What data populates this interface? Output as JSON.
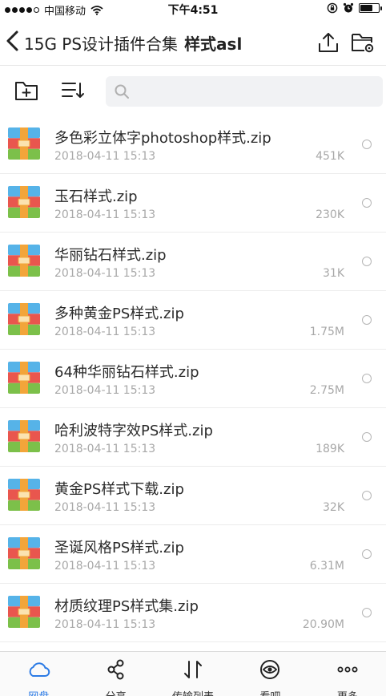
{
  "status_bar": {
    "carrier": "中国移动",
    "time": "下午4:51"
  },
  "nav": {
    "breadcrumb": "15G PS设计插件合集",
    "current_folder": "样式asl"
  },
  "search": {
    "value": "",
    "placeholder": ""
  },
  "files": [
    {
      "name": "多色彩立体字photoshop样式.zip",
      "date": "2018-04-11 15:13",
      "size": "451K"
    },
    {
      "name": "玉石样式.zip",
      "date": "2018-04-11 15:13",
      "size": "230K"
    },
    {
      "name": "华丽钻石样式.zip",
      "date": "2018-04-11 15:13",
      "size": "31K"
    },
    {
      "name": "多种黄金PS样式.zip",
      "date": "2018-04-11 15:13",
      "size": "1.75M"
    },
    {
      "name": "64种华丽钻石样式.zip",
      "date": "2018-04-11 15:13",
      "size": "2.75M"
    },
    {
      "name": "哈利波特字效PS样式.zip",
      "date": "2018-04-11 15:13",
      "size": "189K"
    },
    {
      "name": "黄金PS样式下载.zip",
      "date": "2018-04-11 15:13",
      "size": "32K"
    },
    {
      "name": "圣诞风格PS样式.zip",
      "date": "2018-04-11 15:13",
      "size": "6.31M"
    },
    {
      "name": "材质纹理PS样式集.zip",
      "date": "2018-04-11 15:13",
      "size": "20.90M"
    }
  ],
  "tabs": [
    {
      "label": "网盘",
      "icon": "cloud-icon",
      "active": true
    },
    {
      "label": "分享",
      "icon": "share-icon",
      "active": false
    },
    {
      "label": "传输列表",
      "icon": "transfer-icon",
      "active": false
    },
    {
      "label": "看吧",
      "icon": "eye-icon",
      "active": false
    },
    {
      "label": "更多",
      "icon": "more-icon",
      "active": false
    }
  ],
  "colors": {
    "accent": "#2c7be5",
    "zip_blue": "#56b3e8",
    "zip_red": "#e9564e",
    "zip_green": "#7cc04a",
    "zip_band": "#f2a53a"
  },
  "battery_level": 0.7
}
